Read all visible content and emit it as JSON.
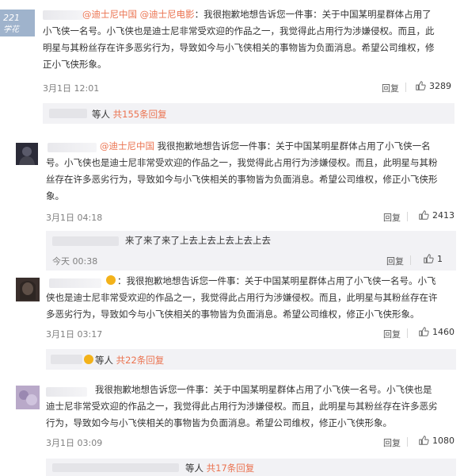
{
  "comments": [
    {
      "mentions": "@迪士尼中国 @迪士尼电影",
      "text_line1": "我很抱歉地想告诉您一件事：关于中国某明星群体占用了",
      "text_line2": "小飞侠一名号。小飞侠也是迪士尼非常受欢迎的作品之一，我觉得此占用行为涉嫌侵权。而且，此",
      "text_line3": "明星与其粉丝存在许多恶劣行为，导致如今与小飞侠相关的事物皆为负面消息。希望公司维权，修",
      "text_line4": "正小飞侠形象。",
      "time": "3月1日 12:01",
      "reply_label": "回复",
      "likes": "3289",
      "sub_prefix": "等人",
      "sub_count": "共155条回复"
    },
    {
      "mentions": "@迪士尼中国",
      "text_line1": "我很抱歉地想告诉您一件事：关于中国某明星群体占用了小飞侠一名",
      "text_line2": "号。小飞侠也是迪士尼非常受欢迎的作品之一，我觉得此占用行为涉嫌侵权。而且，此明星与其粉",
      "text_line3": "丝存在许多恶劣行为，导致如今与小飞侠相关的事物皆为负面消息。希望公司维权，修正小飞侠形",
      "text_line4": "象。",
      "time": "3月1日 04:18",
      "reply_label": "回复",
      "likes": "2413",
      "sub_reply_text": "来了来了来了上去上去上去上去上去",
      "sub_reply_time": "今天 00:38",
      "sub_reply_reply": "回复",
      "sub_reply_likes": "1"
    },
    {
      "text_line1": "我很抱歉地想告诉您一件事：关于中国某明星群体占用了小飞侠一名号。小飞",
      "text_line2": "侠也是迪士尼非常受欢迎的作品之一，我觉得此占用行为涉嫌侵权。而且，此明星与其粉丝存在许",
      "text_line3": "多恶劣行为，导致如今与小飞侠相关的事物皆为负面消息。希望公司维权，修正小飞侠形象。",
      "time": "3月1日 03:17",
      "reply_label": "回复",
      "likes": "1460",
      "sub_prefix": "等人",
      "sub_count": "共22条回复"
    },
    {
      "text_line1": "我很抱歉地想告诉您一件事：关于中国某明星群体占用了小飞侠一名号。小飞侠也是",
      "text_line2": "迪士尼非常受欢迎的作品之一，我觉得此占用行为涉嫌侵权。而且，此明星与其粉丝存在许多恶劣",
      "text_line3": "行为，导致如今与小飞侠相关的事物皆为负面消息。希望公司维权，修正小飞侠形象。",
      "time": "3月1日 03:09",
      "reply_label": "回复",
      "likes": "1080",
      "sub_prefix": "等人",
      "sub_count": "共17条回复"
    }
  ],
  "icons": {
    "like": "thumbs-up-icon"
  }
}
